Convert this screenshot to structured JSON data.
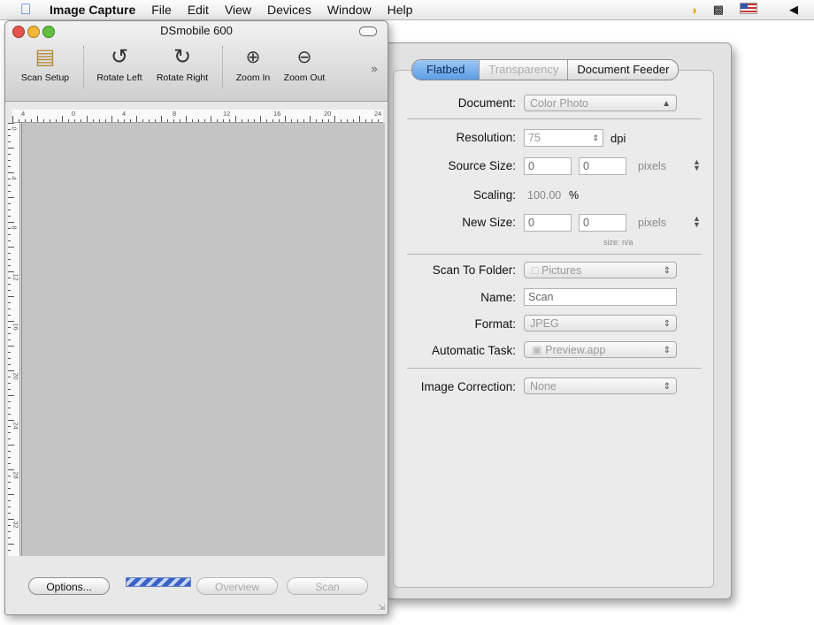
{
  "menubar": {
    "app_name": "Image Capture",
    "items": [
      "File",
      "Edit",
      "View",
      "Devices",
      "Window",
      "Help"
    ]
  },
  "scanner_window": {
    "title": "DSmobile 600",
    "toolbar": {
      "scan_setup": "Scan Setup",
      "rotate_left": "Rotate Left",
      "rotate_right": "Rotate Right",
      "zoom_in": "Zoom In",
      "zoom_out": "Zoom Out",
      "overflow": "»"
    },
    "ruler_h_labels": [
      "4",
      "0",
      "4",
      "8",
      "12",
      "16",
      "20",
      "24"
    ],
    "ruler_v_labels": [
      "0",
      "4",
      "8",
      "12",
      "16",
      "20",
      "24",
      "28",
      "32"
    ],
    "buttons": {
      "options": "Options...",
      "overview": "Overview",
      "scan": "Scan"
    }
  },
  "settings": {
    "tabs": [
      "Flatbed",
      "Transparency",
      "Document Feeder"
    ],
    "document": {
      "label": "Document:",
      "value": "Color Photo"
    },
    "resolution": {
      "label": "Resolution:",
      "value": "75",
      "unit": "dpi"
    },
    "source_size": {
      "label": "Source Size:",
      "w": "0",
      "h": "0",
      "unit": "pixels"
    },
    "scaling": {
      "label": "Scaling:",
      "value": "100.00",
      "unit": "%"
    },
    "new_size": {
      "label": "New Size:",
      "w": "0",
      "h": "0",
      "unit": "pixels",
      "size_note": "size: n/a"
    },
    "scan_to_folder": {
      "label": "Scan To Folder:",
      "value": "Pictures"
    },
    "name": {
      "label": "Name:",
      "value": "Scan"
    },
    "format": {
      "label": "Format:",
      "value": "JPEG"
    },
    "automatic_task": {
      "label": "Automatic Task:",
      "value": "Preview.app"
    },
    "image_correction": {
      "label": "Image Correction:",
      "value": "None"
    }
  },
  "colors": {
    "accent": "#5c9de5",
    "close_light": "#e4544b",
    "minimize_light": "#f3b637",
    "zoom_light": "#5fc13f",
    "progress": "#3a62c8"
  }
}
